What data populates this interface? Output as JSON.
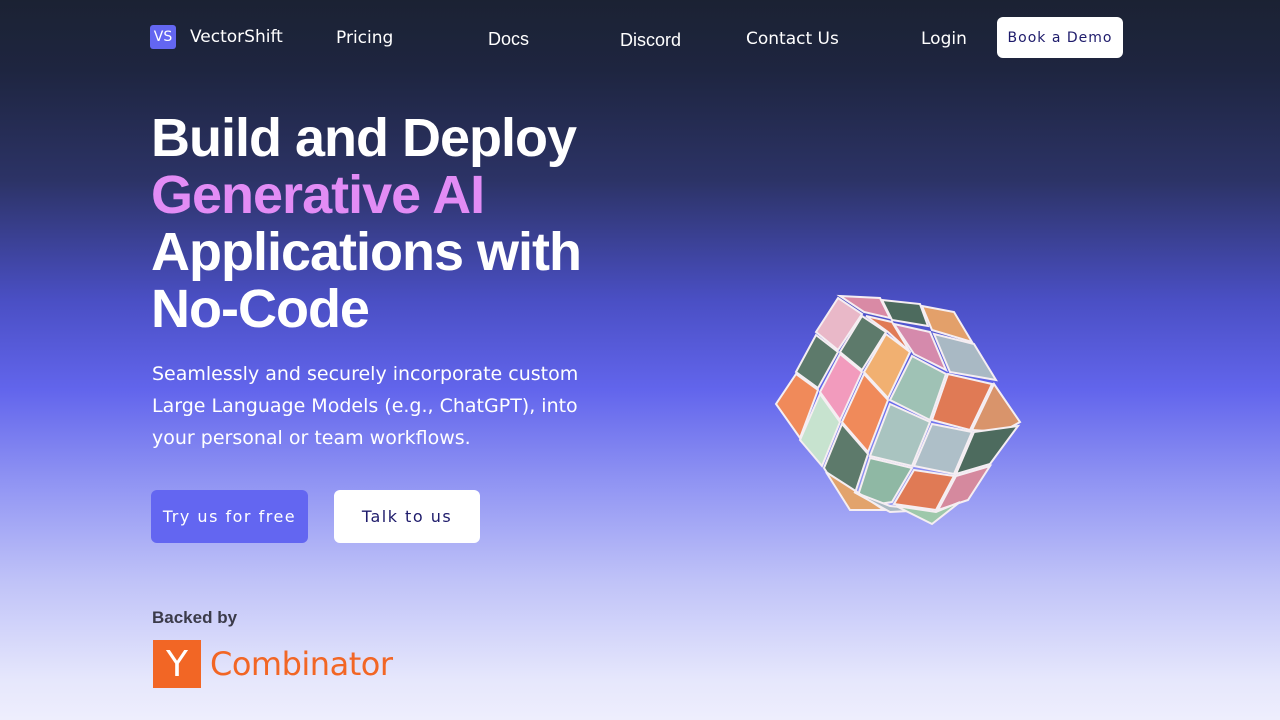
{
  "nav": {
    "logo_badge": "VS",
    "logo_text": "VectorShift",
    "links": [
      "Pricing",
      "Docs",
      "Discord",
      "Contact Us"
    ],
    "login": "Login",
    "demo_button": "Book a Demo"
  },
  "hero": {
    "headline_line1": "Build and Deploy",
    "headline_line2": "Generative AI",
    "headline_line3": "Applications with",
    "headline_line4": "No-Code",
    "subtext": "Seamlessly and securely incorporate custom Large Language Models (e.g., ChatGPT), into your personal or team workflows.",
    "primary_button": "Try us for free",
    "secondary_button": "Talk to us"
  },
  "backing": {
    "label": "Backed by",
    "yc_letter": "Y",
    "yc_name": "Combinator"
  },
  "colors": {
    "accent": "#6366f1",
    "headline_accent": "#e28cf5",
    "yc_orange": "#f26625"
  }
}
